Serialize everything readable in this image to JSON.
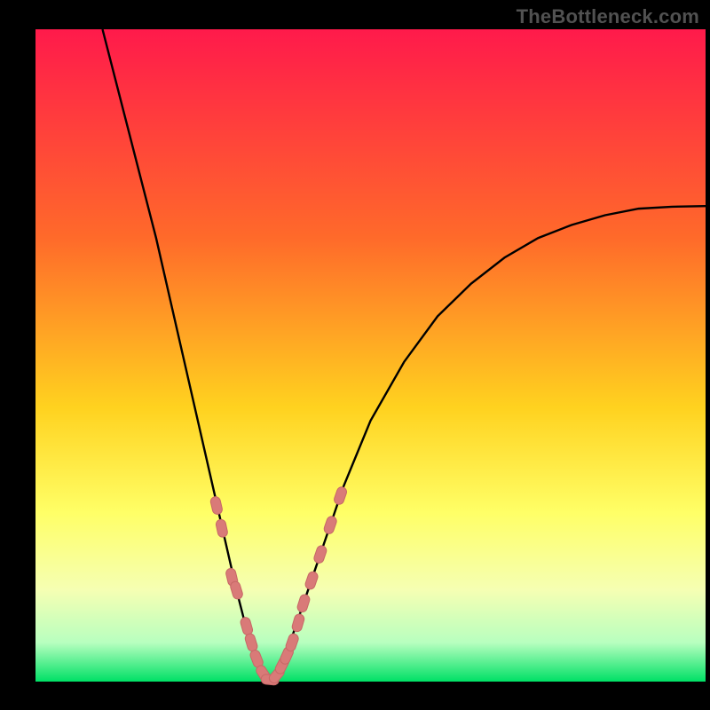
{
  "watermark": "TheBottleneck.com",
  "colors": {
    "bg_black": "#000000",
    "grad_top": "#ff1a4b",
    "grad_mid1": "#ff6a2a",
    "grad_mid2": "#ffd21f",
    "grad_mid3": "#ffff66",
    "grad_low1": "#f5ffb3",
    "grad_low2": "#b8ffbf",
    "grad_bottom": "#00e066",
    "curve": "#000000",
    "marker_fill": "#d97a78",
    "marker_stroke": "#c76866"
  },
  "chart_data": {
    "type": "line",
    "title": "",
    "xlabel": "",
    "ylabel": "",
    "xlim": [
      0,
      100
    ],
    "ylim": [
      0,
      100
    ],
    "curve": {
      "x": [
        10,
        12,
        14,
        16,
        18,
        20,
        22,
        24,
        26,
        28,
        30,
        31,
        32,
        33,
        34,
        35,
        36,
        37,
        38,
        40,
        42,
        44,
        46,
        48,
        50,
        55,
        60,
        65,
        70,
        75,
        80,
        85,
        90,
        95,
        100
      ],
      "y": [
        100,
        92,
        84,
        76,
        68,
        59,
        50,
        41,
        32,
        23,
        14,
        10,
        6,
        3,
        1,
        0,
        1,
        3,
        6,
        12,
        18,
        24,
        30,
        35,
        40,
        49,
        56,
        61,
        65,
        68,
        70,
        71.5,
        72.5,
        72.8,
        72.9
      ]
    },
    "markers": {
      "x": [
        27.0,
        27.8,
        29.3,
        30.0,
        31.5,
        32.2,
        33.0,
        34.0,
        35.0,
        36.0,
        36.8,
        37.5,
        38.3,
        39.2,
        40.0,
        41.2,
        42.5,
        44.0,
        45.5
      ],
      "y": [
        27.0,
        23.5,
        16.0,
        14.0,
        8.5,
        6.0,
        3.5,
        1.2,
        0.3,
        1.0,
        2.5,
        4.0,
        6.0,
        9.0,
        12.0,
        15.5,
        19.5,
        24.0,
        28.5
      ]
    }
  }
}
